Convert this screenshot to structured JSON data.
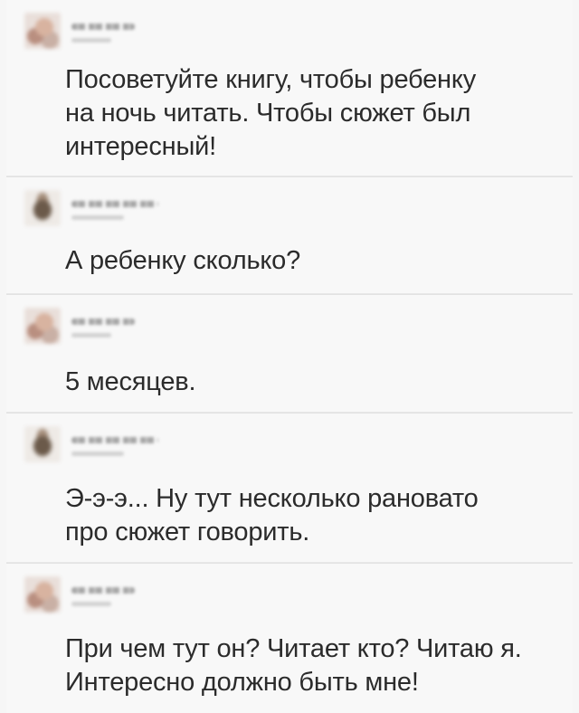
{
  "thread": {
    "posts": [
      {
        "avatar_icon": "user-avatar-pixelated",
        "author_name": "",
        "text": "Посоветуйте книгу, чтобы ребенку\nна ночь читать. Чтобы сюжет был\nинтересный!"
      },
      {
        "avatar_icon": "user-avatar-pixelated",
        "author_name": "",
        "text": "А ребенку сколько?"
      },
      {
        "avatar_icon": "user-avatar-pixelated",
        "author_name": "",
        "text": "5 месяцев."
      },
      {
        "avatar_icon": "user-avatar-pixelated",
        "author_name": "",
        "text": "Э-э-э... Ну тут несколько рановато\nпро сюжет говорить."
      },
      {
        "avatar_icon": "user-avatar-pixelated",
        "author_name": "",
        "text": "При чем тут он? Читает кто? Читаю я.\nИнтересно должно быть мне!"
      }
    ]
  }
}
